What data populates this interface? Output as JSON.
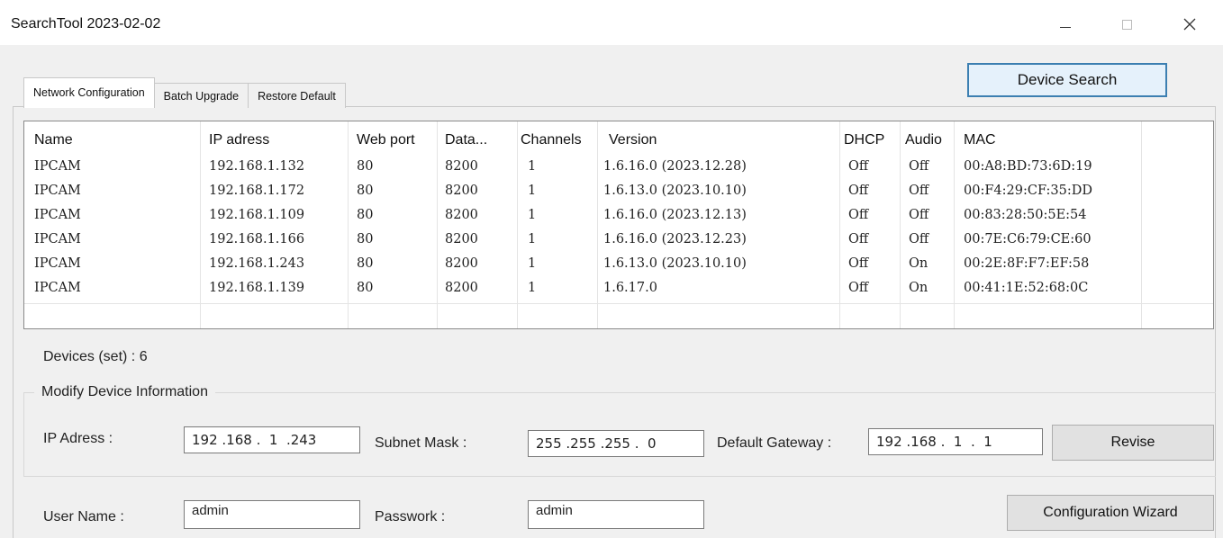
{
  "window": {
    "title": "SearchTool 2023-02-02",
    "controls": [
      "minimize-icon",
      "maximize-icon",
      "close-icon"
    ]
  },
  "tabs": [
    {
      "label": "Network Configuration",
      "active": true
    },
    {
      "label": "Batch Upgrade",
      "active": false
    },
    {
      "label": "Restore Default",
      "active": false
    }
  ],
  "buttons": {
    "device_search": "Device Search",
    "revise": "Revise",
    "config_wizard": "Configuration Wizard"
  },
  "table": {
    "columns": [
      "Name",
      "IP adress",
      "Web port",
      "Data...",
      "Channels",
      "Version",
      "DHCP",
      "Audio",
      "MAC"
    ],
    "rows": [
      [
        "IPCAM",
        "192.168.1.132",
        "80",
        "8200",
        "1",
        "1.6.16.0 (2023.12.28)",
        "Off",
        "Off",
        "00:A8:BD:73:6D:19"
      ],
      [
        "IPCAM",
        "192.168.1.172",
        "80",
        "8200",
        "1",
        "1.6.13.0 (2023.10.10)",
        "Off",
        "Off",
        "00:F4:29:CF:35:DD"
      ],
      [
        "IPCAM",
        "192.168.1.109",
        "80",
        "8200",
        "1",
        "1.6.16.0 (2023.12.13)",
        "Off",
        "Off",
        "00:83:28:50:5E:54"
      ],
      [
        "IPCAM",
        "192.168.1.166",
        "80",
        "8200",
        "1",
        "1.6.16.0 (2023.12.23)",
        "Off",
        "Off",
        "00:7E:C6:79:CE:60"
      ],
      [
        "IPCAM",
        "192.168.1.243",
        "80",
        "8200",
        "1",
        "1.6.13.0 (2023.10.10)",
        "Off",
        "On",
        "00:2E:8F:F7:EF:58"
      ],
      [
        "IPCAM",
        "192.168.1.139",
        "80",
        "8200",
        "1",
        "1.6.17.0",
        "Off",
        "On",
        "00:41:1E:52:68:0C"
      ]
    ]
  },
  "status": {
    "devices_count": "Devices (set) : 6"
  },
  "modify": {
    "group_title": "Modify Device Information",
    "ip_label": "IP Adress :",
    "ip_value": "192 .168 .  1  .243",
    "subnet_label": "Subnet Mask :",
    "subnet_value": "255 .255 .255 .  0",
    "gateway_label": "Default Gateway :",
    "gateway_value": "192 .168 .  1  .  1"
  },
  "account": {
    "user_label": "User Name :",
    "user_value": "admin",
    "password_label": "Passwork :",
    "password_value": "admin"
  },
  "colors": {
    "window_bg": "#f0f0f0",
    "accent_border": "#3c7fb1"
  }
}
